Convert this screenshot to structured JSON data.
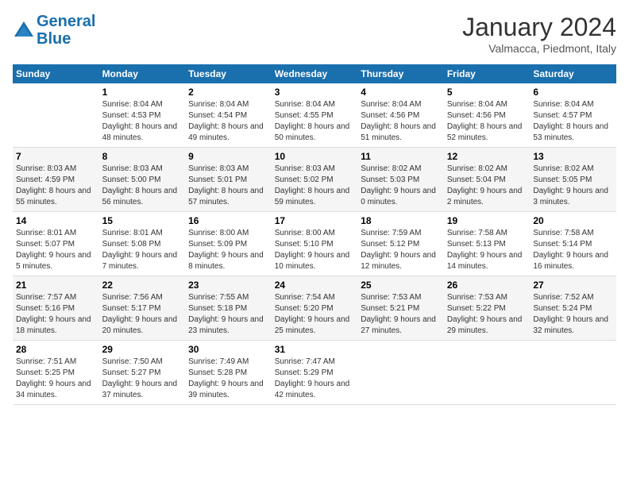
{
  "logo": {
    "line1": "General",
    "line2": "Blue"
  },
  "title": "January 2024",
  "subtitle": "Valmacca, Piedmont, Italy",
  "header": {
    "days": [
      "Sunday",
      "Monday",
      "Tuesday",
      "Wednesday",
      "Thursday",
      "Friday",
      "Saturday"
    ]
  },
  "weeks": [
    [
      {
        "date": "",
        "sunrise": "",
        "sunset": "",
        "daylight": ""
      },
      {
        "date": "1",
        "sunrise": "8:04 AM",
        "sunset": "4:53 PM",
        "daylight": "8 hours and 48 minutes."
      },
      {
        "date": "2",
        "sunrise": "8:04 AM",
        "sunset": "4:54 PM",
        "daylight": "8 hours and 49 minutes."
      },
      {
        "date": "3",
        "sunrise": "8:04 AM",
        "sunset": "4:55 PM",
        "daylight": "8 hours and 50 minutes."
      },
      {
        "date": "4",
        "sunrise": "8:04 AM",
        "sunset": "4:56 PM",
        "daylight": "8 hours and 51 minutes."
      },
      {
        "date": "5",
        "sunrise": "8:04 AM",
        "sunset": "4:56 PM",
        "daylight": "8 hours and 52 minutes."
      },
      {
        "date": "6",
        "sunrise": "8:04 AM",
        "sunset": "4:57 PM",
        "daylight": "8 hours and 53 minutes."
      }
    ],
    [
      {
        "date": "7",
        "sunrise": "8:03 AM",
        "sunset": "4:59 PM",
        "daylight": "8 hours and 55 minutes."
      },
      {
        "date": "8",
        "sunrise": "8:03 AM",
        "sunset": "5:00 PM",
        "daylight": "8 hours and 56 minutes."
      },
      {
        "date": "9",
        "sunrise": "8:03 AM",
        "sunset": "5:01 PM",
        "daylight": "8 hours and 57 minutes."
      },
      {
        "date": "10",
        "sunrise": "8:03 AM",
        "sunset": "5:02 PM",
        "daylight": "8 hours and 59 minutes."
      },
      {
        "date": "11",
        "sunrise": "8:02 AM",
        "sunset": "5:03 PM",
        "daylight": "9 hours and 0 minutes."
      },
      {
        "date": "12",
        "sunrise": "8:02 AM",
        "sunset": "5:04 PM",
        "daylight": "9 hours and 2 minutes."
      },
      {
        "date": "13",
        "sunrise": "8:02 AM",
        "sunset": "5:05 PM",
        "daylight": "9 hours and 3 minutes."
      }
    ],
    [
      {
        "date": "14",
        "sunrise": "8:01 AM",
        "sunset": "5:07 PM",
        "daylight": "9 hours and 5 minutes."
      },
      {
        "date": "15",
        "sunrise": "8:01 AM",
        "sunset": "5:08 PM",
        "daylight": "9 hours and 7 minutes."
      },
      {
        "date": "16",
        "sunrise": "8:00 AM",
        "sunset": "5:09 PM",
        "daylight": "9 hours and 8 minutes."
      },
      {
        "date": "17",
        "sunrise": "8:00 AM",
        "sunset": "5:10 PM",
        "daylight": "9 hours and 10 minutes."
      },
      {
        "date": "18",
        "sunrise": "7:59 AM",
        "sunset": "5:12 PM",
        "daylight": "9 hours and 12 minutes."
      },
      {
        "date": "19",
        "sunrise": "7:58 AM",
        "sunset": "5:13 PM",
        "daylight": "9 hours and 14 minutes."
      },
      {
        "date": "20",
        "sunrise": "7:58 AM",
        "sunset": "5:14 PM",
        "daylight": "9 hours and 16 minutes."
      }
    ],
    [
      {
        "date": "21",
        "sunrise": "7:57 AM",
        "sunset": "5:16 PM",
        "daylight": "9 hours and 18 minutes."
      },
      {
        "date": "22",
        "sunrise": "7:56 AM",
        "sunset": "5:17 PM",
        "daylight": "9 hours and 20 minutes."
      },
      {
        "date": "23",
        "sunrise": "7:55 AM",
        "sunset": "5:18 PM",
        "daylight": "9 hours and 23 minutes."
      },
      {
        "date": "24",
        "sunrise": "7:54 AM",
        "sunset": "5:20 PM",
        "daylight": "9 hours and 25 minutes."
      },
      {
        "date": "25",
        "sunrise": "7:53 AM",
        "sunset": "5:21 PM",
        "daylight": "9 hours and 27 minutes."
      },
      {
        "date": "26",
        "sunrise": "7:53 AM",
        "sunset": "5:22 PM",
        "daylight": "9 hours and 29 minutes."
      },
      {
        "date": "27",
        "sunrise": "7:52 AM",
        "sunset": "5:24 PM",
        "daylight": "9 hours and 32 minutes."
      }
    ],
    [
      {
        "date": "28",
        "sunrise": "7:51 AM",
        "sunset": "5:25 PM",
        "daylight": "9 hours and 34 minutes."
      },
      {
        "date": "29",
        "sunrise": "7:50 AM",
        "sunset": "5:27 PM",
        "daylight": "9 hours and 37 minutes."
      },
      {
        "date": "30",
        "sunrise": "7:49 AM",
        "sunset": "5:28 PM",
        "daylight": "9 hours and 39 minutes."
      },
      {
        "date": "31",
        "sunrise": "7:47 AM",
        "sunset": "5:29 PM",
        "daylight": "9 hours and 42 minutes."
      },
      {
        "date": "",
        "sunrise": "",
        "sunset": "",
        "daylight": ""
      },
      {
        "date": "",
        "sunrise": "",
        "sunset": "",
        "daylight": ""
      },
      {
        "date": "",
        "sunrise": "",
        "sunset": "",
        "daylight": ""
      }
    ]
  ],
  "labels": {
    "sunrise": "Sunrise:",
    "sunset": "Sunset:",
    "daylight": "Daylight:"
  }
}
